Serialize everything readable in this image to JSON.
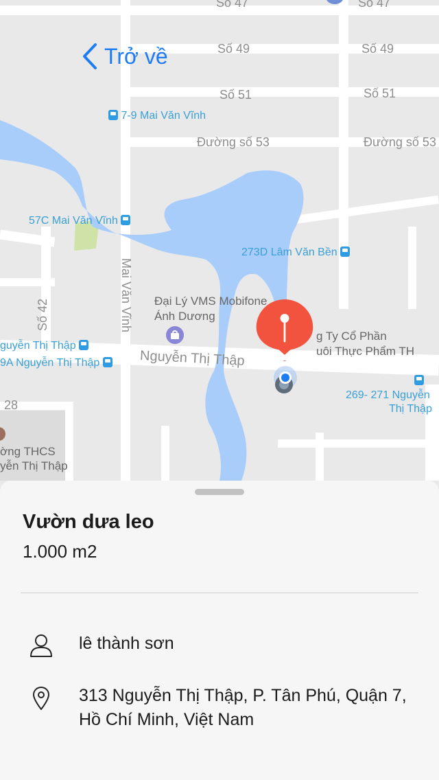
{
  "nav": {
    "back_label": "Trở về"
  },
  "map": {
    "labels": [
      {
        "name": "so-47-left",
        "text": "Số 47"
      },
      {
        "name": "so-47-right",
        "text": "Số 47"
      },
      {
        "name": "so-49-left",
        "text": "Số 49"
      },
      {
        "name": "so-49-right",
        "text": "Số 49"
      },
      {
        "name": "so-51-left",
        "text": "Số 51"
      },
      {
        "name": "so-51-right",
        "text": "Số 51"
      },
      {
        "name": "duong-so-53-left",
        "text": "Đường số 53"
      },
      {
        "name": "duong-so-53-right",
        "text": "Đường số 53"
      },
      {
        "name": "so-42",
        "text": "Số 42"
      },
      {
        "name": "mai-van-vinh-road",
        "text": "Mai Văn Vĩnh"
      },
      {
        "name": "nguyen-thi-thap-road",
        "text": "Nguyễn Thị Thập"
      },
      {
        "name": "num-28",
        "text": "28"
      },
      {
        "name": "poi-dai-ly-1",
        "text": "Đại Lý VMS Mobifone"
      },
      {
        "name": "poi-dai-ly-2",
        "text": "Ánh Dương"
      },
      {
        "name": "poi-cty-1",
        "text": "g Ty Cổ Phần"
      },
      {
        "name": "poi-cty-2",
        "text": "uôi Thực Phẩm TH"
      },
      {
        "name": "poi-thcs-1",
        "text": "ờng THCS"
      },
      {
        "name": "poi-thcs-2",
        "text": "yễn Thị Thập"
      }
    ],
    "bus_stops": [
      {
        "name": "bus-7-9-mai-van-vinh",
        "text": "7-9 Mai Văn Vĩnh"
      },
      {
        "name": "bus-57c-mai-van-vinh",
        "text": "57C Mai Văn Vĩnh"
      },
      {
        "name": "bus-273d-lam-van-ben",
        "text": "273D Lâm Văn Bền"
      },
      {
        "name": "bus-nguyen-thi-thap-1",
        "text": "guyễn Thị Thập"
      },
      {
        "name": "bus-nguyen-thi-thap-2",
        "text": "9A Nguyễn Thị Thập"
      },
      {
        "name": "bus-269-271-line1",
        "text": "269- 271 Nguyễn"
      },
      {
        "name": "bus-269-271-line2",
        "text": "Thị Thập"
      }
    ]
  },
  "detail": {
    "title": "Vườn dưa leo",
    "area": "1.000 m2",
    "owner": "lê thành sơn",
    "address": "313 Nguyễn Thị Thập, P. Tân Phú, Quận 7, Hồ Chí Minh, Việt Nam",
    "icons": [
      "person-icon",
      "location-icon"
    ]
  },
  "colors": {
    "accent": "#1e7cf2",
    "pin": "#f1533f",
    "water": "#a8cdfb",
    "bus": "#2f9be0"
  }
}
